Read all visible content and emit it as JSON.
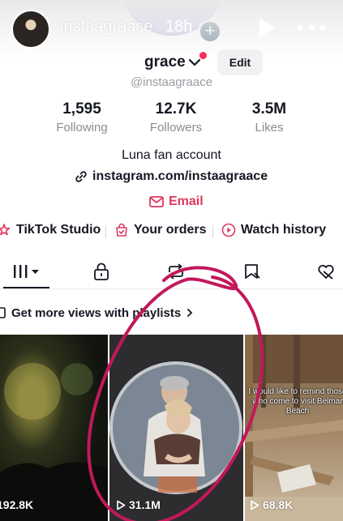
{
  "story": {
    "username": "instaagraace",
    "time": "18h"
  },
  "profile": {
    "name": "grace",
    "handle": "@instaagraace",
    "edit_label": "Edit",
    "stats": [
      {
        "value": "1,595",
        "label": "Following"
      },
      {
        "value": "12.7K",
        "label": "Followers"
      },
      {
        "value": "3.5M",
        "label": "Likes"
      }
    ],
    "bio": "Luna fan account",
    "link": "instagram.com/instaagraace",
    "email_label": "Email"
  },
  "shortcuts": [
    {
      "label": "TikTok Studio"
    },
    {
      "label": "Your orders"
    },
    {
      "label": "Watch history"
    }
  ],
  "tabs": [
    "videos-grid",
    "private",
    "reposts",
    "favorites",
    "liked"
  ],
  "playlist_banner": "Get more views with playlists",
  "videos": [
    {
      "views": "192.8K"
    },
    {
      "views": "31.1M"
    },
    {
      "views": "68.8K"
    }
  ],
  "video3_caption": "I would like to remind those who come to visit Belmar Beach",
  "colors": {
    "accent": "#e0385f",
    "annotation": "#c2185b",
    "text": "#161823"
  }
}
